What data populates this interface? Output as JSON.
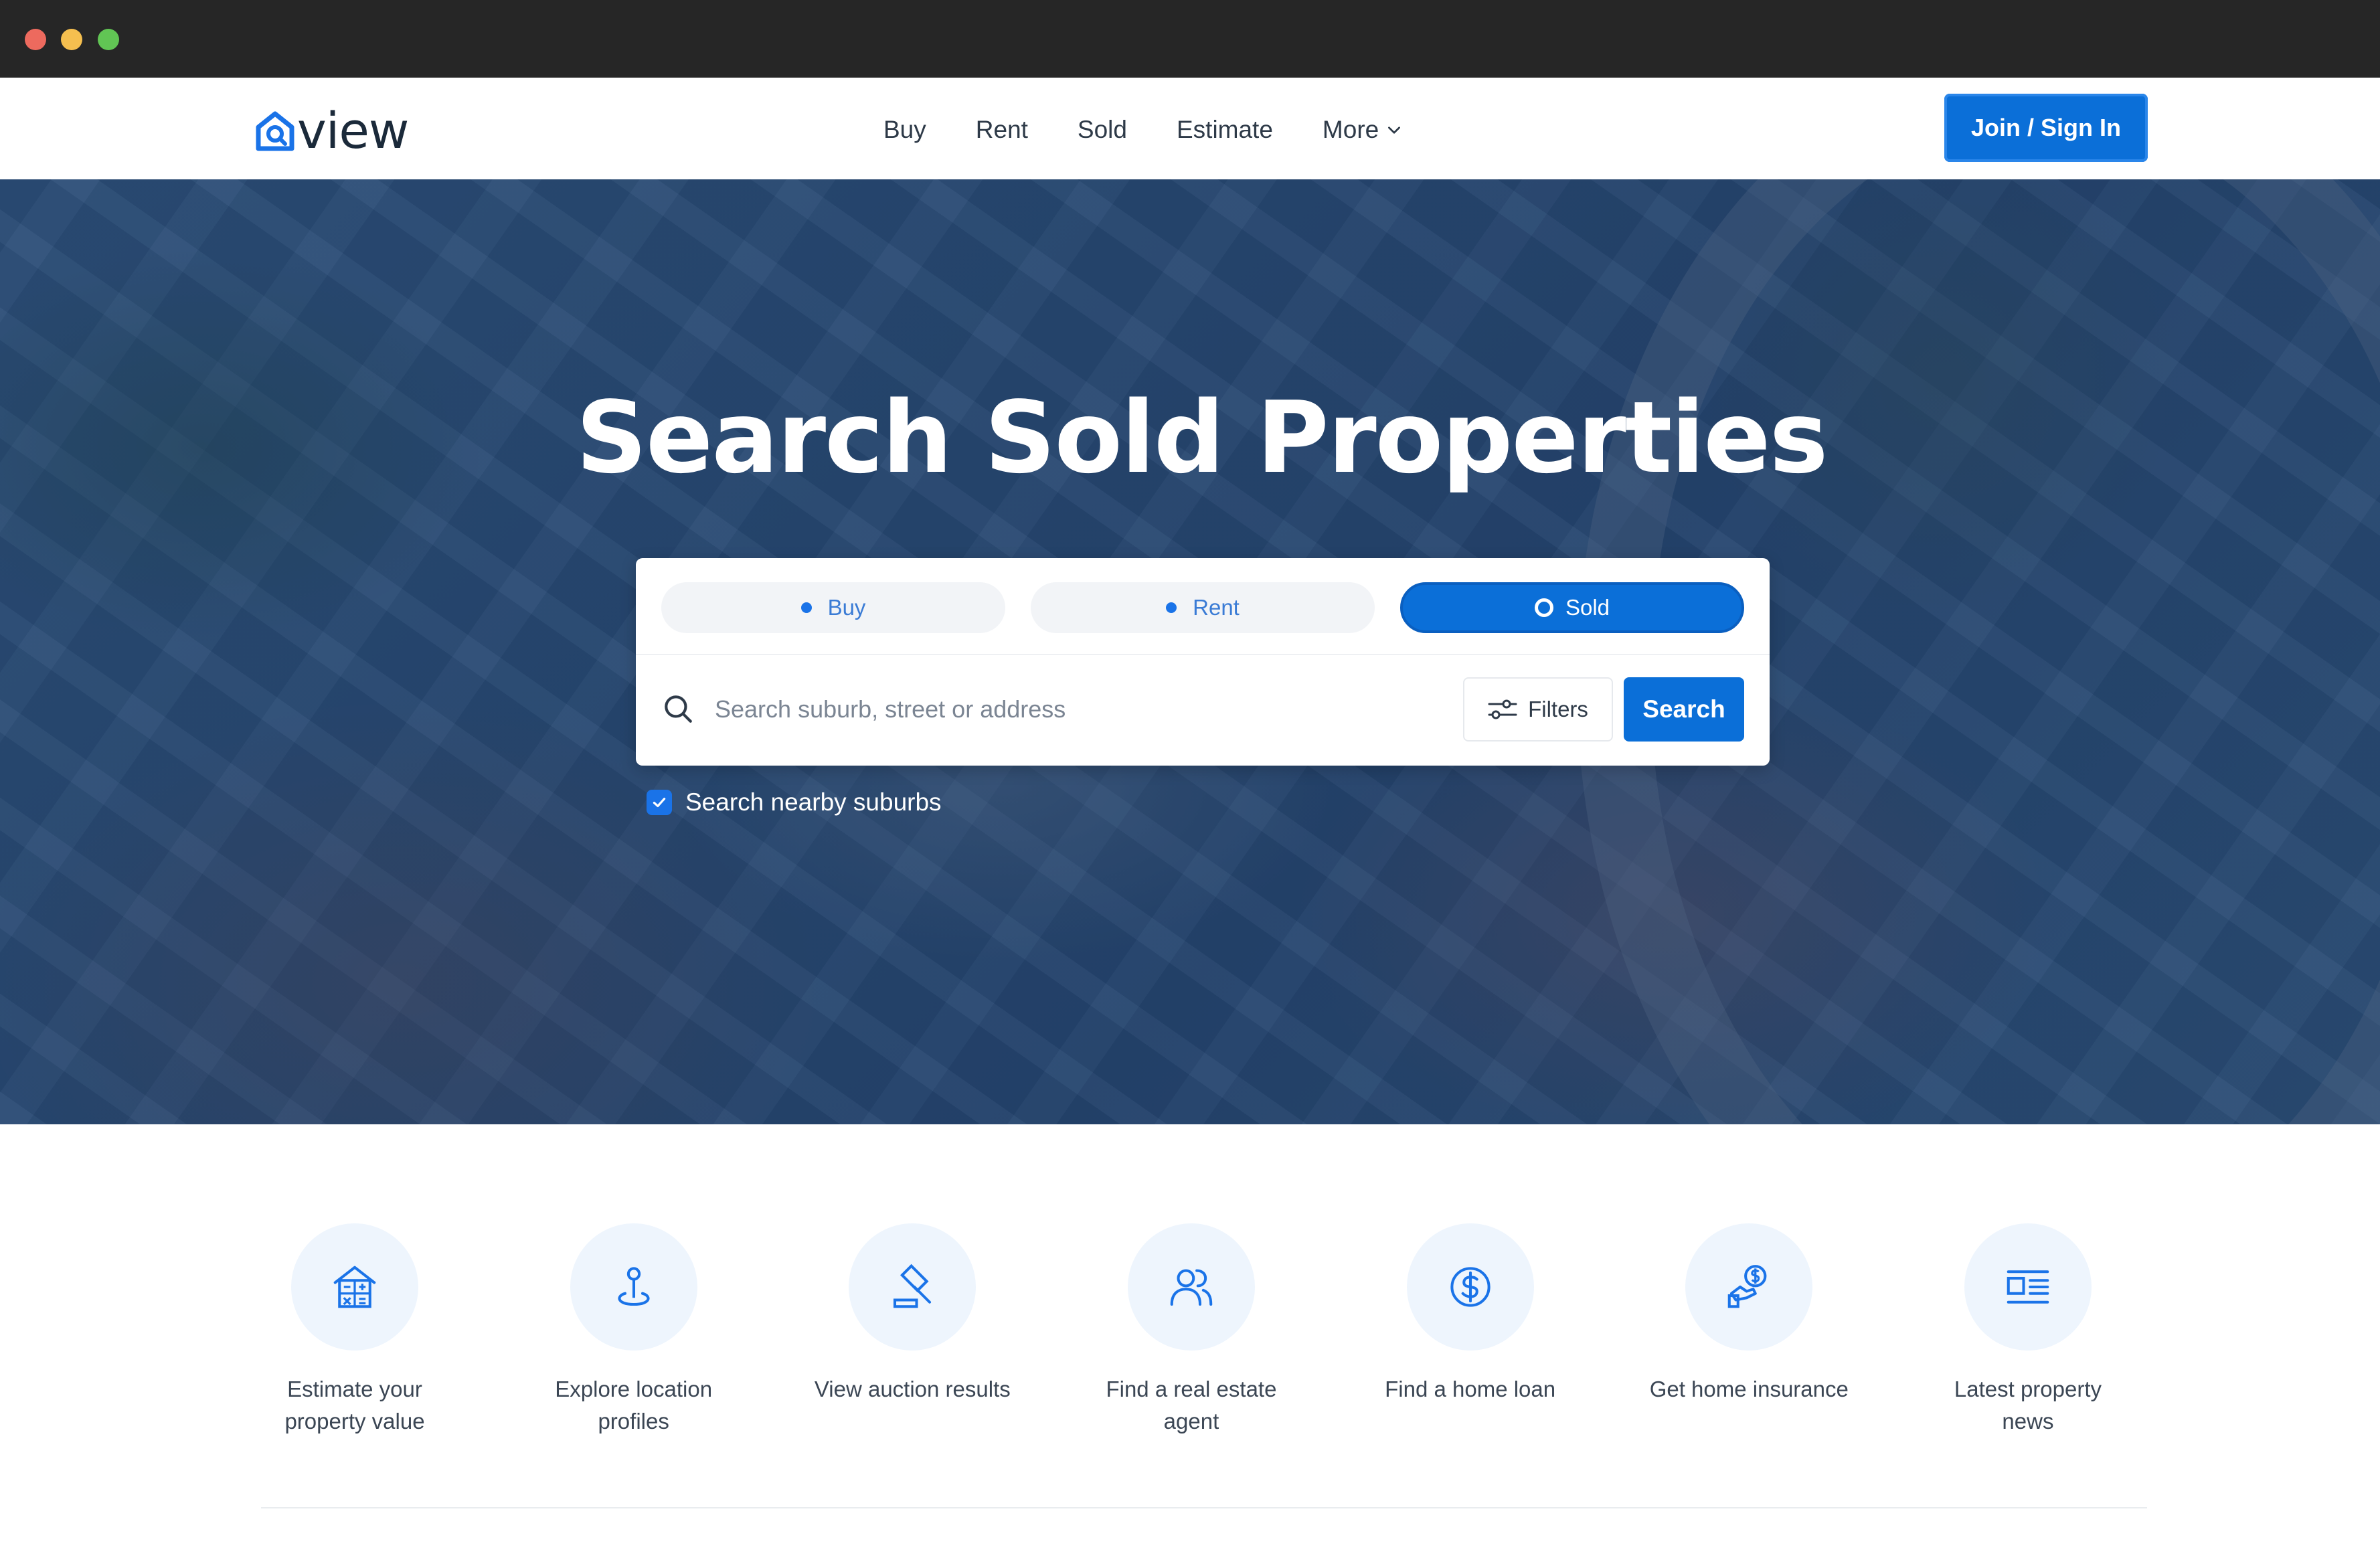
{
  "header": {
    "logo_text": "view",
    "nav": [
      {
        "label": "Buy"
      },
      {
        "label": "Rent"
      },
      {
        "label": "Sold"
      },
      {
        "label": "Estimate"
      },
      {
        "label": "More"
      }
    ],
    "join_label": "Join / Sign In"
  },
  "hero": {
    "title": "Search Sold Properties"
  },
  "search": {
    "tabs": [
      {
        "label": "Buy",
        "active": false
      },
      {
        "label": "Rent",
        "active": false
      },
      {
        "label": "Sold",
        "active": true
      }
    ],
    "placeholder": "Search suburb, street or address",
    "value": "",
    "filters_label": "Filters",
    "search_label": "Search",
    "nearby_label": "Search nearby suburbs",
    "nearby_checked": true
  },
  "services": [
    {
      "label": "Estimate your property value",
      "icon": "house-calculator-icon"
    },
    {
      "label": "Explore location profiles",
      "icon": "location-pin-icon"
    },
    {
      "label": "View auction results",
      "icon": "gavel-icon"
    },
    {
      "label": "Find a real estate agent",
      "icon": "users-icon"
    },
    {
      "label": "Find a home loan",
      "icon": "dollar-circle-icon"
    },
    {
      "label": "Get home insurance",
      "icon": "hand-dollar-icon"
    },
    {
      "label": "Latest property news",
      "icon": "news-icon"
    }
  ],
  "colors": {
    "brand": "#0b6fd8",
    "icon_bg": "#eef5fd"
  }
}
